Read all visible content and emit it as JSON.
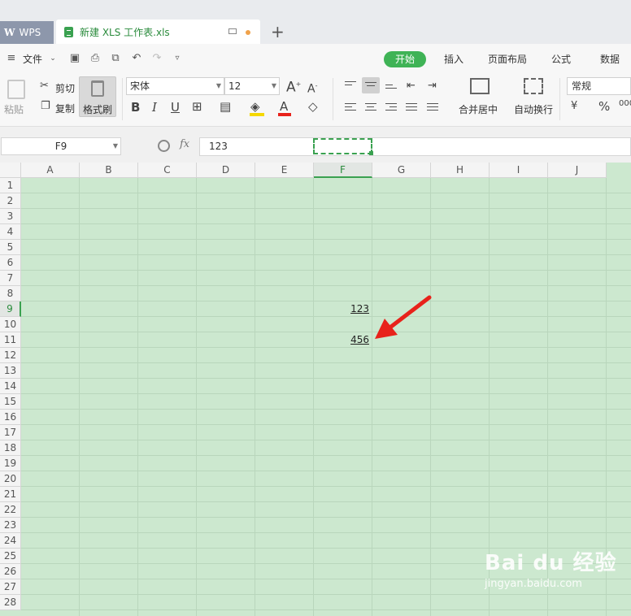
{
  "tabs": {
    "app_name": "WPS",
    "document_name": "新建 XLS 工作表.xls",
    "new_tab": "+"
  },
  "menu": {
    "file": "文件",
    "items": [
      "开始",
      "插入",
      "页面布局",
      "公式",
      "数据"
    ]
  },
  "ribbon": {
    "paste": "粘贴",
    "cut": "剪切",
    "copy": "复制",
    "format_painter": "格式刷",
    "font_name": "宋体",
    "font_size": "12",
    "bold": "B",
    "italic": "I",
    "underline": "U",
    "merge_center": "合并居中",
    "wrap_text": "自动换行",
    "number_format": "常规",
    "currency": "¥",
    "percent": "%",
    "font_color": "A"
  },
  "formula_bar": {
    "name_box": "F9",
    "fx": "fx",
    "value": "123"
  },
  "grid": {
    "columns": [
      "A",
      "B",
      "C",
      "D",
      "E",
      "F",
      "G",
      "H",
      "I",
      "J"
    ],
    "rows": [
      "1",
      "2",
      "3",
      "4",
      "5",
      "6",
      "7",
      "8",
      "9",
      "10",
      "11",
      "12",
      "13",
      "14",
      "15",
      "16",
      "17",
      "18",
      "19",
      "20",
      "21",
      "22",
      "23",
      "24",
      "25",
      "26",
      "27",
      "28"
    ],
    "active_column": "F",
    "active_row": "9",
    "cells": {
      "F9": "123",
      "F11": "456"
    }
  },
  "watermark": {
    "main": "Bai du 经验",
    "sub": "jingyan.baidu.com"
  },
  "colors": {
    "accent": "#3fb356",
    "sheet_bg": "#cce8cf",
    "arrow": "#e8221b"
  }
}
